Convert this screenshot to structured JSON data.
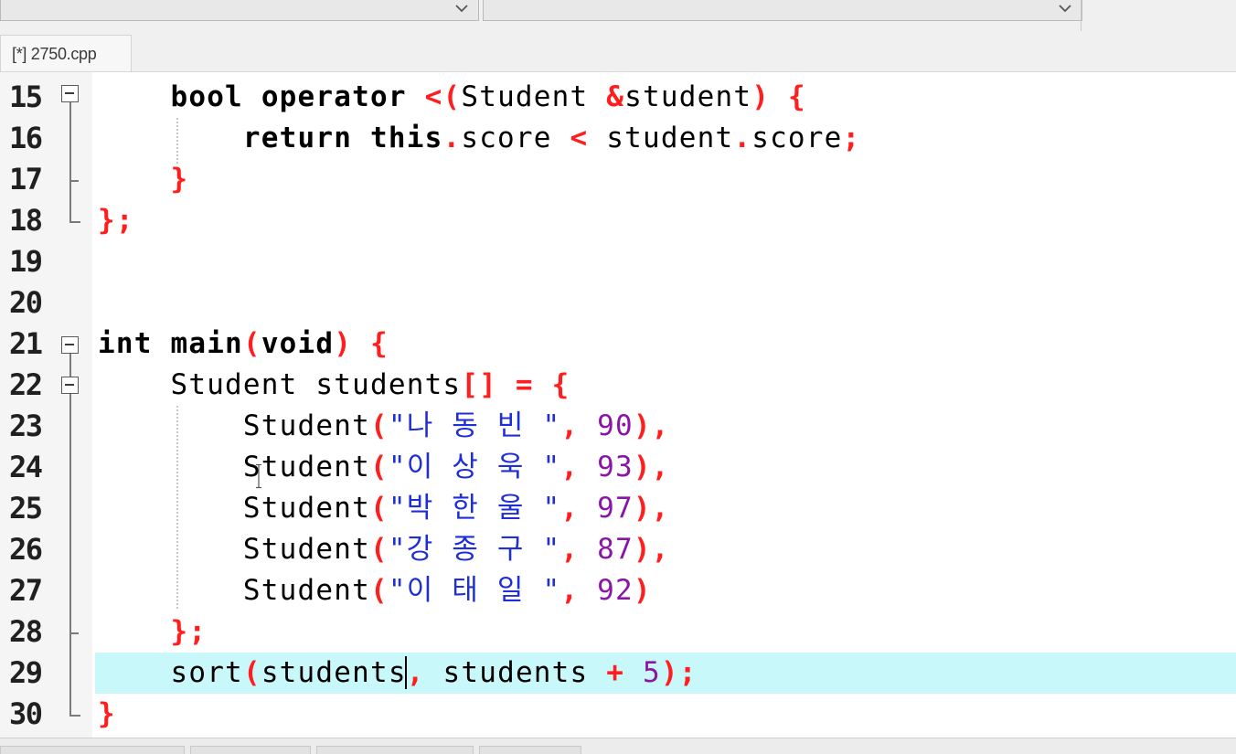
{
  "toolbar": {
    "combo1_value": "",
    "combo2_value": "",
    "icons": [
      "chevron-down-icon",
      "chevron-down-icon"
    ]
  },
  "tabs": [
    {
      "label": "[*] 2750.cpp",
      "active": true
    }
  ],
  "editor": {
    "current_line": 29,
    "lines": [
      {
        "number": "15"
      },
      {
        "number": "16"
      },
      {
        "number": "17"
      },
      {
        "number": "18"
      },
      {
        "number": "19"
      },
      {
        "number": "20"
      },
      {
        "number": "21"
      },
      {
        "number": "22"
      },
      {
        "number": "23"
      },
      {
        "number": "24"
      },
      {
        "number": "25"
      },
      {
        "number": "26"
      },
      {
        "number": "27"
      },
      {
        "number": "28"
      },
      {
        "number": "29"
      },
      {
        "number": "30"
      }
    ],
    "code": {
      "l15": {
        "kw1": "bool",
        "kw2": "operator",
        "op": "<(",
        "type": "Student",
        "amp": "&",
        "param": "student",
        "close": ")",
        "brace": "{"
      },
      "l16": {
        "kw1": "return",
        "kw2": "this",
        "dot1": ".",
        "field1": "score",
        "lt": "<",
        "obj": "student",
        "dot2": ".",
        "field2": "score",
        "semi": ";"
      },
      "l17": {
        "brace": "}"
      },
      "l18": {
        "brace": "};"
      },
      "l21": {
        "kw1": "int",
        "name": "main",
        "open": "(",
        "kw2": "void",
        "close": ")",
        "brace": "{"
      },
      "l22": {
        "type": "Student",
        "name": "students",
        "brackets": "[]",
        "eq": "=",
        "brace": "{"
      },
      "rows": [
        {
          "ctor": "Student",
          "open": "(",
          "str": "\"나 동 빈 \"",
          "comma1": ",",
          "num": "90",
          "close": "),",
          "comma2": ""
        },
        {
          "ctor": "Student",
          "open": "(",
          "str": "\"이 상 욱 \"",
          "comma1": ",",
          "num": "93",
          "close": "),",
          "comma2": ""
        },
        {
          "ctor": "Student",
          "open": "(",
          "str": "\"박 한 울 \"",
          "comma1": ",",
          "num": "97",
          "close": "),",
          "comma2": ""
        },
        {
          "ctor": "Student",
          "open": "(",
          "str": "\"강 종 구 \"",
          "comma1": ",",
          "num": "87",
          "close": "),",
          "comma2": ""
        },
        {
          "ctor": "Student",
          "open": "(",
          "str": "\"이 태 일 \"",
          "comma1": ",",
          "num": "92",
          "close": ")",
          "comma2": ""
        }
      ],
      "l28": {
        "brace": "};"
      },
      "l29": {
        "fn": "sort",
        "open": "(",
        "arg1": "students",
        "comma": ",",
        "arg2": "students",
        "plus": "+",
        "num": "5",
        "close": ");"
      },
      "l30": {
        "brace": "}"
      }
    }
  },
  "colors": {
    "keyword": "#000000",
    "symbol": "#ff1d1d",
    "string": "#1f2fd6",
    "number": "#8a16a6",
    "current_line_bg": "#c9f8fb",
    "gutter_bg": "#f5f5f5"
  }
}
